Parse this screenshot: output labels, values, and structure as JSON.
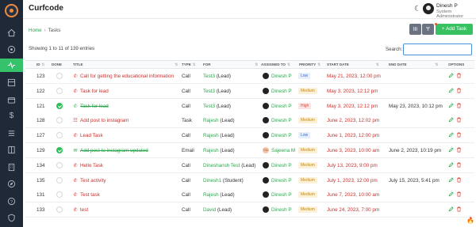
{
  "app": {
    "title": "Curfcode"
  },
  "user": {
    "name": "Dinesh P",
    "role": "System Administrator"
  },
  "breadcrumb": {
    "home": "Home",
    "separator": "›",
    "current": "Tasks"
  },
  "toolbar": {
    "add_label": "+ Add Task"
  },
  "table_info": {
    "entries": "Showing 1 to 11 of 139 entries"
  },
  "search": {
    "label": "Search:",
    "value": ""
  },
  "columns": [
    "ID",
    "DONE",
    "TITLE",
    "TYPE",
    "FOR",
    "ASSIGNED TO",
    "PRIORITY",
    "START DATE",
    "END DATE",
    "OPTIONS"
  ],
  "rows": [
    {
      "id": "123",
      "done": false,
      "type_icon": "phone",
      "title": "Call for getting the educational information",
      "type": "Call",
      "for_name": "Test3",
      "for_tag": "(Lead)",
      "assignee": "Dinesh P",
      "assignee_avatar": "",
      "priority": "Low",
      "priority_class": "low",
      "start": "May 21, 2023, 12:00 pm",
      "end": ""
    },
    {
      "id": "122",
      "done": false,
      "type_icon": "phone",
      "title": "Task for lead",
      "type": "Call",
      "for_name": "Test3",
      "for_tag": "(Lead)",
      "assignee": "Dinesh P",
      "assignee_avatar": "",
      "priority": "Medium",
      "priority_class": "medium",
      "start": "May 3, 2023, 12:12 pm",
      "end": ""
    },
    {
      "id": "121",
      "done": true,
      "type_icon": "phone",
      "title": "Task for lead",
      "type": "Call",
      "for_name": "Test3",
      "for_tag": "(Lead)",
      "assignee": "Dinesh P",
      "assignee_avatar": "",
      "priority": "High",
      "priority_class": "high",
      "start": "May 3, 2023, 12:12 pm",
      "end": "May 23, 2023, 10:12 pm"
    },
    {
      "id": "128",
      "done": false,
      "type_icon": "list",
      "title": "Add post to instagram",
      "type": "Task",
      "for_name": "Rajesh",
      "for_tag": "(Lead)",
      "assignee": "Dinesh P",
      "assignee_avatar": "",
      "priority": "Medium",
      "priority_class": "medium",
      "start": "June 2, 2023, 12:02 pm",
      "end": ""
    },
    {
      "id": "127",
      "done": false,
      "type_icon": "phone",
      "title": "Lead Task",
      "type": "Call",
      "for_name": "Rajesh",
      "for_tag": "(Lead)",
      "assignee": "Dinesh P",
      "assignee_avatar": "",
      "priority": "Low",
      "priority_class": "low",
      "start": "June 1, 2023, 12:00 pm",
      "end": ""
    },
    {
      "id": "129",
      "done": true,
      "type_icon": "mail",
      "title": "Add post to instagram updated",
      "type": "Email",
      "for_name": "Rajesh",
      "for_tag": "(Lead)",
      "assignee": "Sajeena M",
      "assignee_avatar": "SM",
      "priority": "Medium",
      "priority_class": "medium",
      "start": "June 3, 2023, 10:00 am",
      "end": "June 2, 2023, 10:19 pm"
    },
    {
      "id": "134",
      "done": false,
      "type_icon": "phone",
      "title": "Hello Task",
      "type": "Call",
      "for_name": "Dineshansh Test",
      "for_tag": "(Lead)",
      "assignee": "Dinesh P",
      "assignee_avatar": "",
      "priority": "Medium",
      "priority_class": "medium",
      "start": "July 13, 2023, 9:00 pm",
      "end": ""
    },
    {
      "id": "135",
      "done": false,
      "type_icon": "phone",
      "title": "Test activity",
      "type": "Call",
      "for_name": "Dinesh1",
      "for_tag": "(Student)",
      "assignee": "Dinesh P",
      "assignee_avatar": "",
      "priority": "Medium",
      "priority_class": "medium",
      "start": "July 1, 2023, 12:00 pm",
      "end": "July 15, 2023, 5:41 pm"
    },
    {
      "id": "131",
      "done": false,
      "type_icon": "phone",
      "title": "Test task",
      "type": "Call",
      "for_name": "Rajesh",
      "for_tag": "(Lead)",
      "assignee": "Dinesh P",
      "assignee_avatar": "",
      "priority": "Medium",
      "priority_class": "medium",
      "start": "June 7, 2023, 10:00 am",
      "end": ""
    },
    {
      "id": "133",
      "done": false,
      "type_icon": "phone",
      "title": "test",
      "type": "Call",
      "for_name": "David",
      "for_tag": "(Lead)",
      "assignee": "Dinesh P",
      "assignee_avatar": "",
      "priority": "Medium",
      "priority_class": "medium",
      "start": "June 24, 2023, 7:00 pm",
      "end": ""
    }
  ],
  "sidebar": {
    "icons": [
      "logo",
      "home-icon",
      "target-icon",
      "activity-icon",
      "grid-icon",
      "wallet-icon",
      "dollar-icon",
      "list-icon",
      "book-icon",
      "building-icon",
      "compass-icon",
      "help-icon",
      "shield-icon"
    ]
  },
  "colors": {
    "accent": "#37c160",
    "danger": "#c9302c",
    "sidebar": "#1f2937"
  }
}
